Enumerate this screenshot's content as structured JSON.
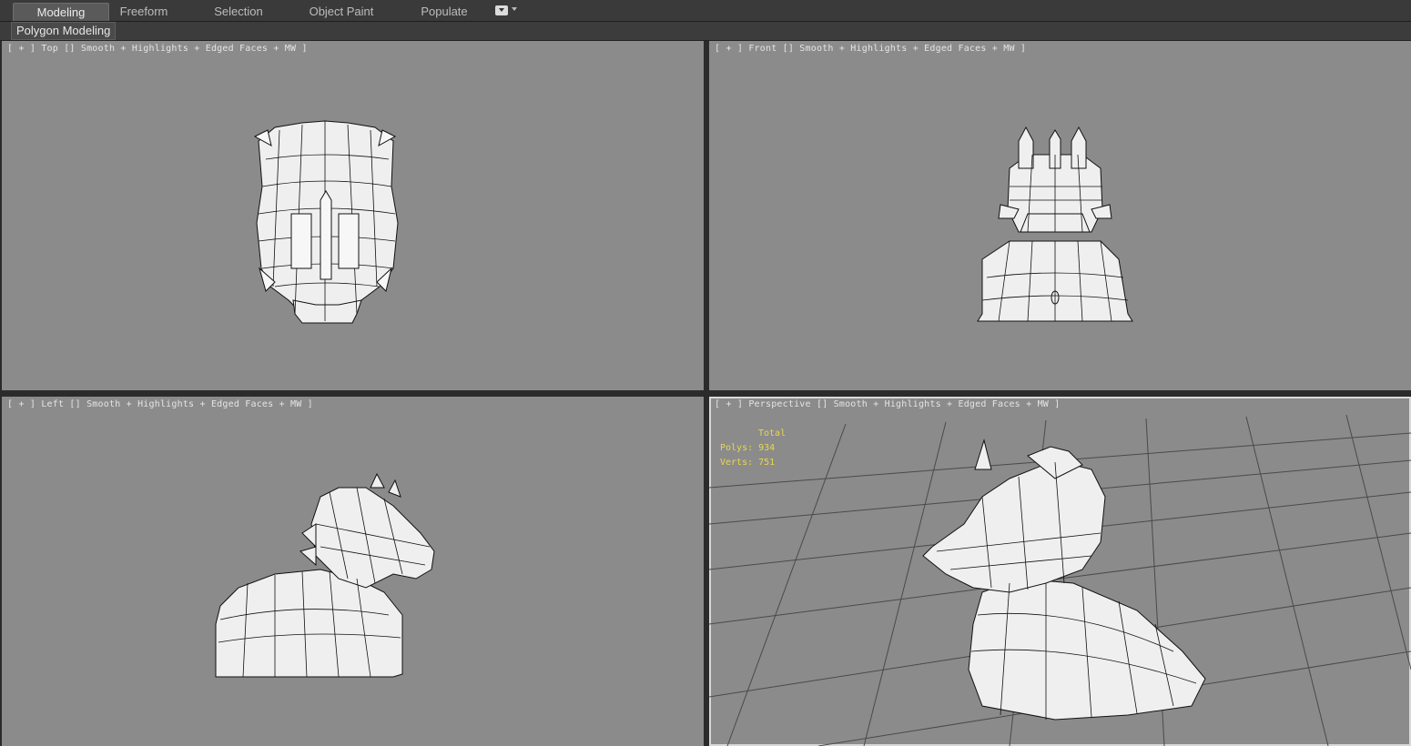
{
  "tabs": [
    {
      "label": "Modeling",
      "active": true
    },
    {
      "label": "Freeform",
      "active": false
    },
    {
      "label": "Selection",
      "active": false
    },
    {
      "label": "Object Paint",
      "active": false
    },
    {
      "label": "Populate",
      "active": false
    }
  ],
  "ribbon": {
    "panel_label": "Polygon Modeling"
  },
  "viewports": {
    "top": {
      "label": "[ + ] Top [] Smooth + Highlights + Edged Faces + MW ]"
    },
    "front": {
      "label": "[ + ] Front [] Smooth + Highlights + Edged Faces + MW ]"
    },
    "left": {
      "label": "[ + ] Left [] Smooth + Highlights + Edged Faces + MW ]"
    },
    "perspective": {
      "label": "[ + ] Perspective [] Smooth + Highlights + Edged Faces + MW ]"
    }
  },
  "stats": {
    "header": "Total",
    "polys": "Polys: 934",
    "verts": "Verts: 751"
  },
  "colors": {
    "viewport_bg": "#8b8b8b",
    "stats_text": "#e8d84a",
    "ui_dark": "#3a3a3a"
  }
}
